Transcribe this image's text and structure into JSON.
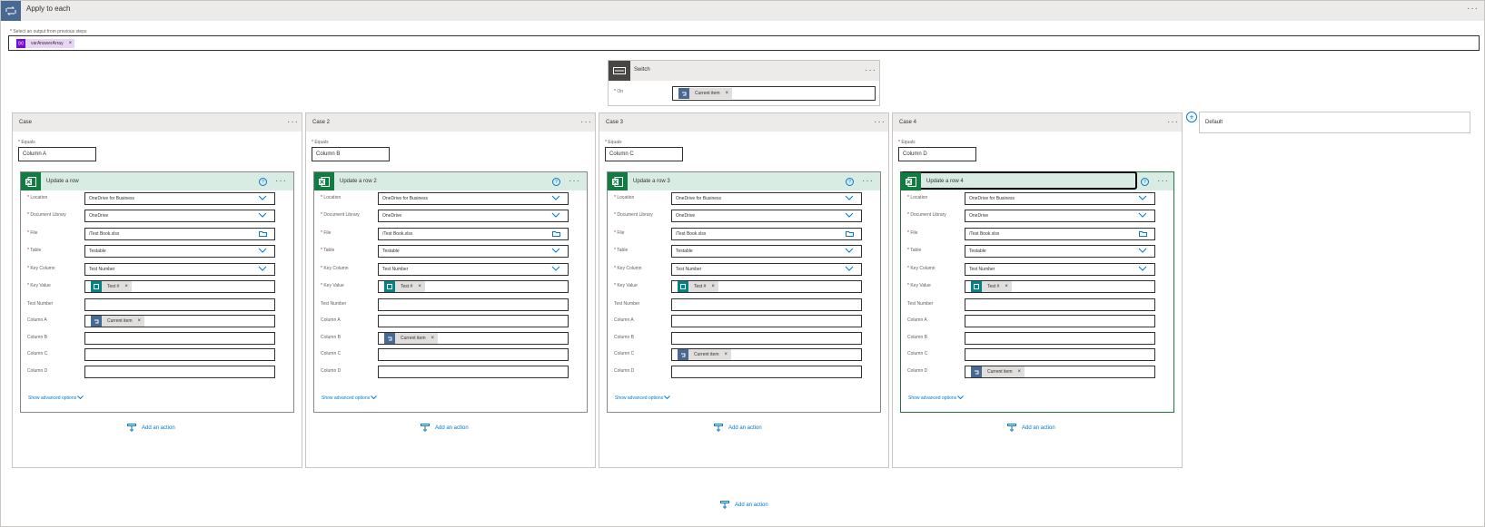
{
  "apply_to_each": {
    "title": "Apply to each",
    "select_label": "Select an output from previous steps",
    "token": "varAnswerArray",
    "token_icon_text": "{x}",
    "more": "···"
  },
  "switch": {
    "title": "Switch",
    "on_label": "On",
    "on_token": "Current item",
    "more": "···"
  },
  "field_labels": [
    "Location",
    "Document Library",
    "File",
    "Table",
    "Key Column",
    "Key Value",
    "Test Number",
    "Column A",
    "Column B",
    "Column C",
    "Column D"
  ],
  "equals_label": "Equals",
  "show_advanced": "Show advanced options",
  "add_action": "Add an action",
  "default_case": "Default",
  "help_glyph": "?",
  "cases": [
    {
      "title": "Case",
      "equals": "Column A",
      "action_title": "Update a row",
      "location": "OneDrive for Business",
      "library": "OneDrive",
      "file": "/Test Book.xlsx",
      "table": "Testable",
      "key_column": "Test Number",
      "key_value": "Test #",
      "current_item": "Current item"
    },
    {
      "title": "Case 2",
      "equals": "Column B",
      "action_title": "Update a row 2",
      "location": "OneDrive for Business",
      "library": "OneDrive",
      "file": "/Test Book.xlsx",
      "table": "Testable",
      "key_column": "Test Number",
      "key_value": "Test #",
      "current_item": "Current item"
    },
    {
      "title": "Case 3",
      "equals": "Column C",
      "action_title": "Update a row 3",
      "location": "OneDrive for Business",
      "library": "OneDrive",
      "file": "/Test Book.xlsx",
      "table": "Testable",
      "key_column": "Test Number",
      "key_value": "Test #",
      "current_item": "Current item"
    },
    {
      "title": "Case 4",
      "equals": "Column D",
      "action_title": "Update a row 4",
      "location": "OneDrive for Business",
      "library": "OneDrive",
      "file": "/Test Book.xlsx",
      "table": "Testable",
      "key_column": "Test Number",
      "key_value": "Test #",
      "current_item": "Current item"
    }
  ],
  "colors": {
    "loop_blue": "#486991",
    "excel_green": "#107c41",
    "variable_purple": "#770bd6",
    "link_blue": "#0078d4",
    "required_red": "#a4262c"
  }
}
